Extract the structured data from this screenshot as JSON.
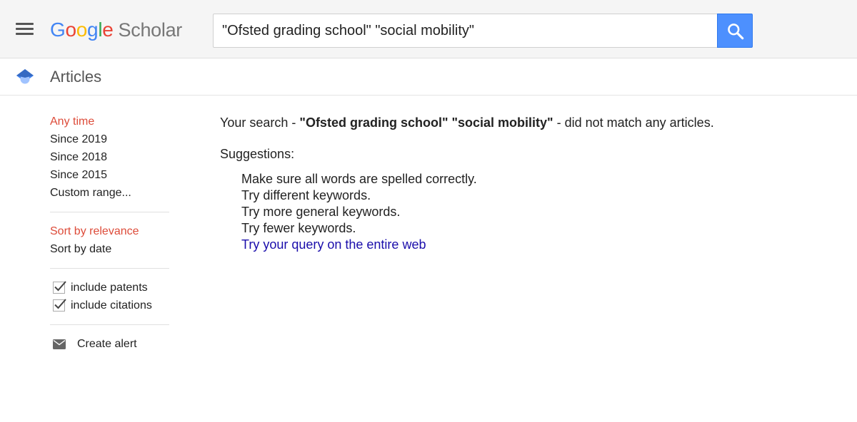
{
  "header": {
    "logo_letters": [
      "G",
      "o",
      "o",
      "g",
      "l",
      "e"
    ],
    "logo_product": "Scholar",
    "search_value": "\"Ofsted grading school\" \"social mobility\"",
    "icons": {
      "menu": "hamburger-menu-icon",
      "search": "search-icon"
    }
  },
  "subheader": {
    "label": "Articles",
    "icon": "scholar-cap-icon"
  },
  "sidebar": {
    "time_filters": [
      {
        "label": "Any time",
        "selected": true
      },
      {
        "label": "Since 2019",
        "selected": false
      },
      {
        "label": "Since 2018",
        "selected": false
      },
      {
        "label": "Since 2015",
        "selected": false
      },
      {
        "label": "Custom range...",
        "selected": false
      }
    ],
    "sort_options": [
      {
        "label": "Sort by relevance",
        "selected": true
      },
      {
        "label": "Sort by date",
        "selected": false
      }
    ],
    "checkboxes": [
      {
        "label": "include patents",
        "checked": true
      },
      {
        "label": "include citations",
        "checked": true
      }
    ],
    "create_alert": "Create alert"
  },
  "main": {
    "message_prefix": "Your search - ",
    "message_query": "\"Ofsted grading school\" \"social mobility\"",
    "message_suffix": " - did not match any articles.",
    "suggestions_title": "Suggestions:",
    "suggestions": [
      "Make sure all words are spelled correctly.",
      "Try different keywords.",
      "Try more general keywords.",
      "Try fewer keywords."
    ],
    "web_link": "Try your query on the entire web"
  },
  "colors": {
    "google_blue": "#4285f4",
    "google_red": "#ea4335",
    "google_yellow": "#fbbc05",
    "google_green": "#34a853",
    "selected_red": "#dd4b39",
    "link_blue": "#1a0dab",
    "search_button": "#4d90fe",
    "header_bg": "#f5f5f5"
  }
}
